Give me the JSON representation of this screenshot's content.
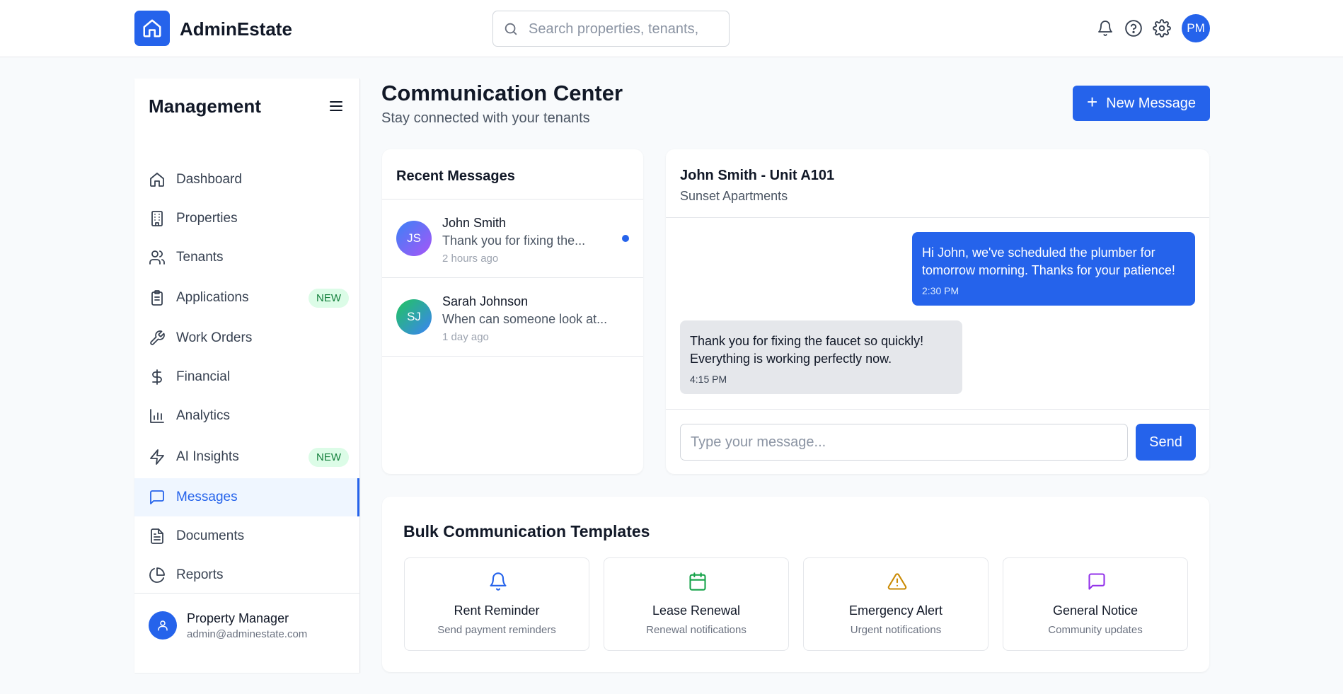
{
  "app": {
    "brand": "AdminEstate",
    "brand_color": "#2563eb"
  },
  "topbar": {
    "search_placeholder": "Search properties, tenants,",
    "icons": [
      "bell-icon",
      "help-circle-icon",
      "gear-icon"
    ],
    "user_initials": "PM"
  },
  "sidebar": {
    "title": "Management",
    "items": [
      {
        "label": "Dashboard",
        "icon": "home-icon"
      },
      {
        "label": "Properties",
        "icon": "building-icon"
      },
      {
        "label": "Tenants",
        "icon": "users-icon"
      },
      {
        "label": "Applications",
        "icon": "clipboard-icon",
        "badge": "NEW"
      },
      {
        "label": "Work Orders",
        "icon": "wrench-icon"
      },
      {
        "label": "Financial",
        "icon": "dollar-icon"
      },
      {
        "label": "Analytics",
        "icon": "bar-chart-icon"
      },
      {
        "label": "AI Insights",
        "icon": "lightning-icon",
        "badge": "NEW"
      },
      {
        "label": "Messages",
        "icon": "message-icon",
        "active": true
      },
      {
        "label": "Documents",
        "icon": "document-icon"
      },
      {
        "label": "Reports",
        "icon": "pie-chart-icon"
      }
    ],
    "user": {
      "name": "Property Manager",
      "email": "admin@adminestate.com"
    }
  },
  "header": {
    "title": "Communication Center",
    "subtitle": "Stay connected with your tenants",
    "new_message_label": "New Message"
  },
  "recent": {
    "title": "Recent Messages",
    "conversations": [
      {
        "initials": "JS",
        "name": "John Smith",
        "preview": "Thank you for fixing the...",
        "time": "2 hours ago",
        "unread": true
      },
      {
        "initials": "SJ",
        "name": "Sarah Johnson",
        "preview": "When can someone look at...",
        "time": "1 day ago",
        "unread": false
      }
    ]
  },
  "chat": {
    "title": "John Smith - Unit A101",
    "subtitle": "Sunset Apartments",
    "messages": [
      {
        "direction": "out",
        "text": "Hi John, we've scheduled the plumber for tomorrow morning. Thanks for your patience!",
        "time": "2:30 PM"
      },
      {
        "direction": "in",
        "text": "Thank you for fixing the faucet so quickly! Everything is working perfectly now.",
        "time": "4:15 PM"
      }
    ],
    "input_placeholder": "Type your message...",
    "send_label": "Send"
  },
  "bulk": {
    "title": "Bulk Communication Templates",
    "templates": [
      {
        "name": "Rent Reminder",
        "desc": "Send payment reminders",
        "icon": "bell-icon",
        "color": "#2563eb"
      },
      {
        "name": "Lease Renewal",
        "desc": "Renewal notifications",
        "icon": "calendar-icon",
        "color": "#16a34a"
      },
      {
        "name": "Emergency Alert",
        "desc": "Urgent notifications",
        "icon": "warning-icon",
        "color": "#ca8a04"
      },
      {
        "name": "General Notice",
        "desc": "Community updates",
        "icon": "message-icon",
        "color": "#9333ea"
      }
    ]
  }
}
